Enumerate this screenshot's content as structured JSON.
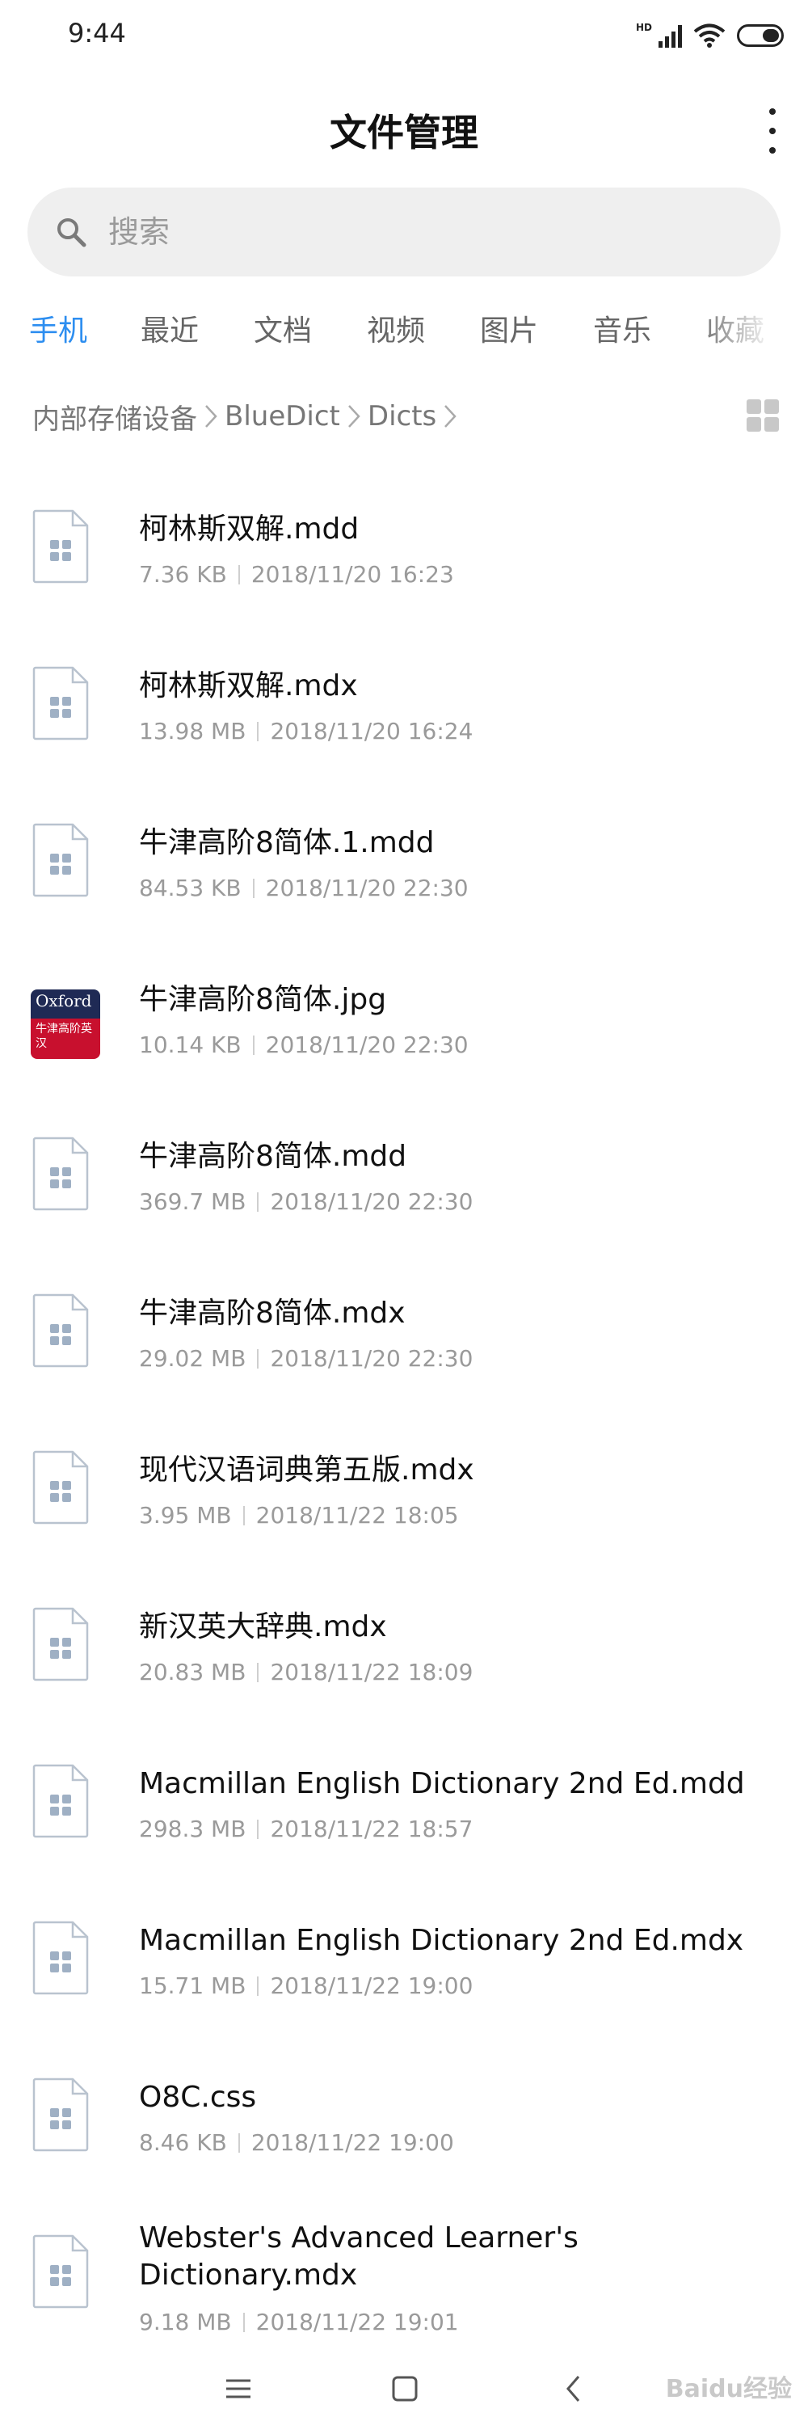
{
  "status_bar": {
    "time": "9:44",
    "hd_label": "HD",
    "icons": [
      "signal-icon",
      "wifi-icon",
      "battery-icon"
    ]
  },
  "header": {
    "title": "文件管理"
  },
  "search": {
    "placeholder": "搜索"
  },
  "tabs": [
    {
      "label": "手机",
      "active": true
    },
    {
      "label": "最近"
    },
    {
      "label": "文档"
    },
    {
      "label": "视频"
    },
    {
      "label": "图片"
    },
    {
      "label": "音乐"
    },
    {
      "label": "收藏"
    }
  ],
  "breadcrumb": [
    "内部存储设备",
    "BlueDict",
    "Dicts"
  ],
  "files": [
    {
      "name": "柯林斯双解.mdd",
      "size": "7.36 KB",
      "date": "2018/11/20 16:23",
      "icon": "file-icon"
    },
    {
      "name": "柯林斯双解.mdx",
      "size": "13.98 MB",
      "date": "2018/11/20 16:24",
      "icon": "file-icon"
    },
    {
      "name": "牛津高阶8简体.1.mdd",
      "size": "84.53 KB",
      "date": "2018/11/20 22:30",
      "icon": "file-icon"
    },
    {
      "name": "牛津高阶8简体.jpg",
      "size": "10.14 KB",
      "date": "2018/11/20 22:30",
      "icon": "image-thumbnail",
      "thumb_brand": "Oxford",
      "thumb_sub": "牛津高阶英汉"
    },
    {
      "name": "牛津高阶8简体.mdd",
      "size": "369.7 MB",
      "date": "2018/11/20 22:30",
      "icon": "file-icon"
    },
    {
      "name": "牛津高阶8简体.mdx",
      "size": "29.02 MB",
      "date": "2018/11/20 22:30",
      "icon": "file-icon"
    },
    {
      "name": "现代汉语词典第五版.mdx",
      "size": "3.95 MB",
      "date": "2018/11/22 18:05",
      "icon": "file-icon"
    },
    {
      "name": "新汉英大辞典.mdx",
      "size": "20.83 MB",
      "date": "2018/11/22 18:09",
      "icon": "file-icon"
    },
    {
      "name": "Macmillan English Dictionary 2nd Ed.mdd",
      "size": "298.3 MB",
      "date": "2018/11/22 18:57",
      "icon": "file-icon"
    },
    {
      "name": "Macmillan English Dictionary 2nd Ed.mdx",
      "size": "15.71 MB",
      "date": "2018/11/22 19:00",
      "icon": "file-icon"
    },
    {
      "name": "O8C.css",
      "size": "8.46 KB",
      "date": "2018/11/22 19:00",
      "icon": "file-icon"
    },
    {
      "name": "Webster's Advanced Learner's Dictionary.mdx",
      "size": "9.18 MB",
      "date": "2018/11/22 19:01",
      "icon": "file-icon"
    }
  ],
  "watermark": "Baidu经验",
  "colors": {
    "accent": "#2d8ef0",
    "icon_gray": "#9fb0c4"
  }
}
